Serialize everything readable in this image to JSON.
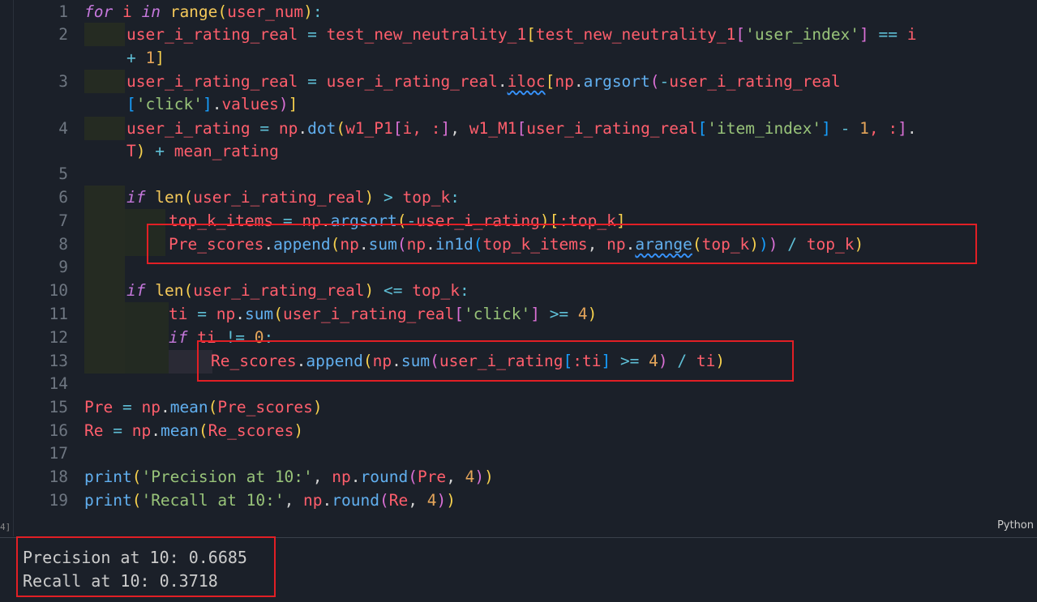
{
  "language_label": "Python",
  "exec_count_marker": "4]",
  "line_numbers": [
    "1",
    "2",
    "3",
    "4",
    "5",
    "6",
    "7",
    "8",
    "9",
    "10",
    "11",
    "12",
    "13",
    "14",
    "15",
    "16",
    "17",
    "18",
    "19"
  ],
  "code": {
    "l1": [
      [
        "for",
        "kw"
      ],
      [
        " i ",
        "id"
      ],
      [
        "in",
        "kw"
      ],
      [
        " ",
        "plain"
      ],
      [
        "range",
        "fnc"
      ],
      [
        "(",
        "p1"
      ],
      [
        "user_num",
        "id"
      ],
      [
        ")",
        "p1"
      ],
      [
        ":",
        "op"
      ]
    ],
    "l2a": [
      [
        "user_i_rating_real",
        "id"
      ],
      [
        " = ",
        "op"
      ],
      [
        "test_new_neutrality_1",
        "id"
      ],
      [
        "[",
        "p1"
      ],
      [
        "test_new_neutrality_1",
        "id"
      ],
      [
        "[",
        "p2"
      ],
      [
        "'user_index'",
        "str"
      ],
      [
        "]",
        "p2"
      ],
      [
        " == ",
        "op"
      ],
      [
        "i",
        "id"
      ]
    ],
    "l2b": [
      [
        "+ ",
        "op"
      ],
      [
        "1",
        "num"
      ],
      [
        "]",
        "p1"
      ]
    ],
    "l3a": [
      [
        "user_i_rating_real",
        "id"
      ],
      [
        " = ",
        "op"
      ],
      [
        "user_i_rating_real",
        "id"
      ],
      [
        ".",
        "plain"
      ],
      [
        "iloc",
        "id",
        "wavy"
      ],
      [
        "[",
        "p1"
      ],
      [
        "np",
        "id"
      ],
      [
        ".",
        "plain"
      ],
      [
        "argsort",
        "fn"
      ],
      [
        "(",
        "p2"
      ],
      [
        "-",
        "op"
      ],
      [
        "user_i_rating_real",
        "id"
      ]
    ],
    "l3b": [
      [
        "[",
        "p3"
      ],
      [
        "'click'",
        "str"
      ],
      [
        "]",
        "p3"
      ],
      [
        ".",
        "plain"
      ],
      [
        "values",
        "id"
      ],
      [
        ")",
        "p2"
      ],
      [
        "]",
        "p1"
      ]
    ],
    "l4a": [
      [
        "user_i_rating",
        "id"
      ],
      [
        " = ",
        "op"
      ],
      [
        "np",
        "id"
      ],
      [
        ".",
        "plain"
      ],
      [
        "dot",
        "fn"
      ],
      [
        "(",
        "p1"
      ],
      [
        "w1_P1",
        "id"
      ],
      [
        "[",
        "p2"
      ],
      [
        "i, :",
        "id"
      ],
      [
        "]",
        "p2"
      ],
      [
        ", ",
        "plain"
      ],
      [
        "w1_M1",
        "id"
      ],
      [
        "[",
        "p2"
      ],
      [
        "user_i_rating_real",
        "id"
      ],
      [
        "[",
        "p3"
      ],
      [
        "'item_index'",
        "str"
      ],
      [
        "]",
        "p3"
      ],
      [
        " - ",
        "op"
      ],
      [
        "1",
        "num"
      ],
      [
        ", :",
        "id"
      ],
      [
        "]",
        "p2"
      ],
      [
        ".",
        "plain"
      ]
    ],
    "l4b": [
      [
        "T",
        "id"
      ],
      [
        ")",
        "p1"
      ],
      [
        " + ",
        "op"
      ],
      [
        "mean_rating",
        "id"
      ]
    ],
    "l6": [
      [
        "if",
        "kw"
      ],
      [
        " ",
        "plain"
      ],
      [
        "len",
        "fnc"
      ],
      [
        "(",
        "p1"
      ],
      [
        "user_i_rating_real",
        "id"
      ],
      [
        ")",
        "p1"
      ],
      [
        " > ",
        "op"
      ],
      [
        "top_k",
        "id"
      ],
      [
        ":",
        "op"
      ]
    ],
    "l7": [
      [
        "top_k_items",
        "id"
      ],
      [
        " = ",
        "op"
      ],
      [
        "np",
        "id"
      ],
      [
        ".",
        "plain"
      ],
      [
        "argsort",
        "fn"
      ],
      [
        "(",
        "p1"
      ],
      [
        "-",
        "op"
      ],
      [
        "user_i_rating",
        "id"
      ],
      [
        ")",
        "p1"
      ],
      [
        "[",
        "p1"
      ],
      [
        ":top_k",
        "id"
      ],
      [
        "]",
        "p1"
      ]
    ],
    "l8": [
      [
        "Pre_scores",
        "id"
      ],
      [
        ".",
        "plain"
      ],
      [
        "append",
        "fn"
      ],
      [
        "(",
        "p1"
      ],
      [
        "np",
        "id"
      ],
      [
        ".",
        "plain"
      ],
      [
        "sum",
        "fn"
      ],
      [
        "(",
        "p2"
      ],
      [
        "np",
        "id"
      ],
      [
        ".",
        "plain"
      ],
      [
        "in1d",
        "fn"
      ],
      [
        "(",
        "p3"
      ],
      [
        "top_k_items",
        "id"
      ],
      [
        ", ",
        "plain"
      ],
      [
        "np",
        "id"
      ],
      [
        ".",
        "plain"
      ],
      [
        "arange",
        "fn",
        "wavy"
      ],
      [
        "(",
        "p1"
      ],
      [
        "top_k",
        "id"
      ],
      [
        ")",
        "p1"
      ],
      [
        ")",
        "p3"
      ],
      [
        ")",
        "p2"
      ],
      [
        " / ",
        "op"
      ],
      [
        "top_k",
        "id"
      ],
      [
        ")",
        "p1"
      ]
    ],
    "l10": [
      [
        "if",
        "kw"
      ],
      [
        " ",
        "plain"
      ],
      [
        "len",
        "fnc"
      ],
      [
        "(",
        "p1"
      ],
      [
        "user_i_rating_real",
        "id"
      ],
      [
        ")",
        "p1"
      ],
      [
        " <= ",
        "op"
      ],
      [
        "top_k",
        "id"
      ],
      [
        ":",
        "op"
      ]
    ],
    "l11": [
      [
        "ti",
        "id"
      ],
      [
        " = ",
        "op"
      ],
      [
        "np",
        "id"
      ],
      [
        ".",
        "plain"
      ],
      [
        "sum",
        "fn"
      ],
      [
        "(",
        "p1"
      ],
      [
        "user_i_rating_real",
        "id"
      ],
      [
        "[",
        "p2"
      ],
      [
        "'click'",
        "str"
      ],
      [
        "]",
        "p2"
      ],
      [
        " >= ",
        "op"
      ],
      [
        "4",
        "num"
      ],
      [
        ")",
        "p1"
      ]
    ],
    "l12": [
      [
        "if",
        "kw"
      ],
      [
        " ",
        "plain"
      ],
      [
        "ti",
        "id"
      ],
      [
        " != ",
        "op"
      ],
      [
        "0",
        "num"
      ],
      [
        ":",
        "op"
      ]
    ],
    "l13": [
      [
        "Re_scores",
        "id"
      ],
      [
        ".",
        "plain"
      ],
      [
        "append",
        "fn"
      ],
      [
        "(",
        "p1"
      ],
      [
        "np",
        "id"
      ],
      [
        ".",
        "plain"
      ],
      [
        "sum",
        "fn"
      ],
      [
        "(",
        "p2"
      ],
      [
        "user_i_rating",
        "id"
      ],
      [
        "[",
        "p3"
      ],
      [
        ":ti",
        "id"
      ],
      [
        "]",
        "p3"
      ],
      [
        " >= ",
        "op"
      ],
      [
        "4",
        "num"
      ],
      [
        ")",
        "p2"
      ],
      [
        " / ",
        "op"
      ],
      [
        "ti",
        "id"
      ],
      [
        ")",
        "p1"
      ]
    ],
    "l15": [
      [
        "Pre",
        "id"
      ],
      [
        " = ",
        "op"
      ],
      [
        "np",
        "id"
      ],
      [
        ".",
        "plain"
      ],
      [
        "mean",
        "fn"
      ],
      [
        "(",
        "p1"
      ],
      [
        "Pre_scores",
        "id"
      ],
      [
        ")",
        "p1"
      ]
    ],
    "l16": [
      [
        "Re",
        "id"
      ],
      [
        " = ",
        "op"
      ],
      [
        "np",
        "id"
      ],
      [
        ".",
        "plain"
      ],
      [
        "mean",
        "fn"
      ],
      [
        "(",
        "p1"
      ],
      [
        "Re_scores",
        "id"
      ],
      [
        ")",
        "p1"
      ]
    ],
    "l18": [
      [
        "print",
        "fn"
      ],
      [
        "(",
        "p1"
      ],
      [
        "'Precision at 10:'",
        "str"
      ],
      [
        ", ",
        "plain"
      ],
      [
        "np",
        "id"
      ],
      [
        ".",
        "plain"
      ],
      [
        "round",
        "fn"
      ],
      [
        "(",
        "p2"
      ],
      [
        "Pre",
        "id"
      ],
      [
        ", ",
        "plain"
      ],
      [
        "4",
        "num"
      ],
      [
        ")",
        "p2"
      ],
      [
        ")",
        "p1"
      ]
    ],
    "l19": [
      [
        "print",
        "fn"
      ],
      [
        "(",
        "p1"
      ],
      [
        "'Recall at 10:'",
        "str"
      ],
      [
        ", ",
        "plain"
      ],
      [
        "np",
        "id"
      ],
      [
        ".",
        "plain"
      ],
      [
        "round",
        "fn"
      ],
      [
        "(",
        "p2"
      ],
      [
        "Re",
        "id"
      ],
      [
        ", ",
        "plain"
      ],
      [
        "4",
        "num"
      ],
      [
        ")",
        "p2"
      ],
      [
        ")",
        "p1"
      ]
    ]
  },
  "output": {
    "line1": "Precision at 10: 0.6685",
    "line2": "Recall at 10: 0.3718"
  },
  "colors": {
    "background": "#1b2029",
    "highlight_box": "#e21f25"
  }
}
